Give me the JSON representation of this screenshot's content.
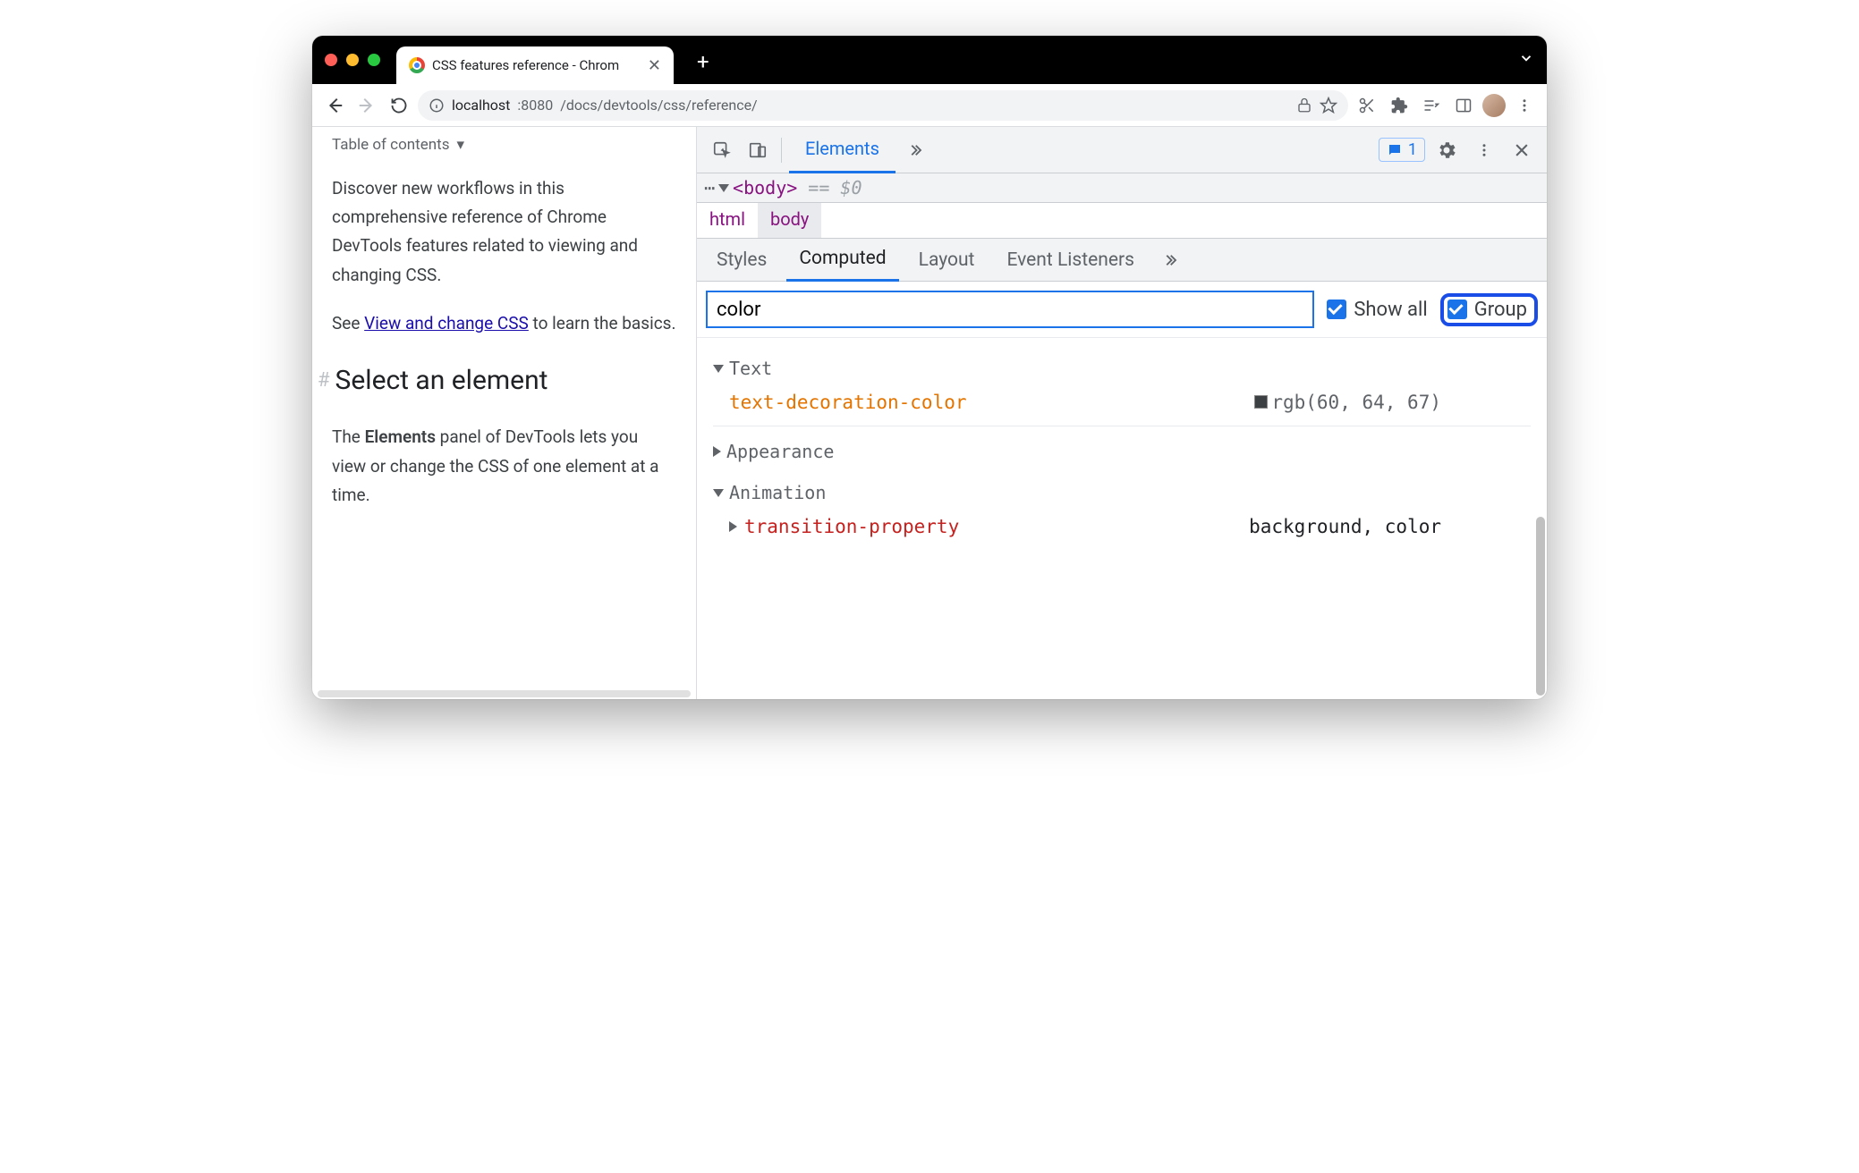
{
  "tab": {
    "title": "CSS features reference - Chrom"
  },
  "nav": {
    "url_host": "localhost",
    "url_port": ":8080",
    "url_path": "/docs/devtools/css/reference/"
  },
  "page": {
    "toc": "Table of contents",
    "p1a": "Discover new workflows in this comprehensive reference of Chrome DevTools features related to viewing and changing CSS.",
    "p2_pre": "See ",
    "p2_link": "View and change CSS",
    "p2_post": " to learn the basics.",
    "h2": "Select an element",
    "p3_pre": "The ",
    "p3_strong": "Elements",
    "p3_post": " panel of DevTools lets you view or change the CSS of one element at a time."
  },
  "devtools": {
    "top_tab": "Elements",
    "msg_count": "1",
    "dom_tag": "<body>",
    "dom_suffix": "== $0",
    "breadcrumb": {
      "a": "html",
      "b": "body"
    },
    "subtabs": {
      "a": "Styles",
      "b": "Computed",
      "c": "Layout",
      "d": "Event Listeners"
    },
    "filter_value": "color",
    "chk_showall": "Show all",
    "chk_group": "Group",
    "groups": {
      "text": {
        "label": "Text",
        "prop": "text-decoration-color",
        "val": "rgb(60, 64, 67)"
      },
      "appearance": {
        "label": "Appearance"
      },
      "animation": {
        "label": "Animation",
        "prop": "transition-property",
        "val": "background, color"
      }
    }
  }
}
